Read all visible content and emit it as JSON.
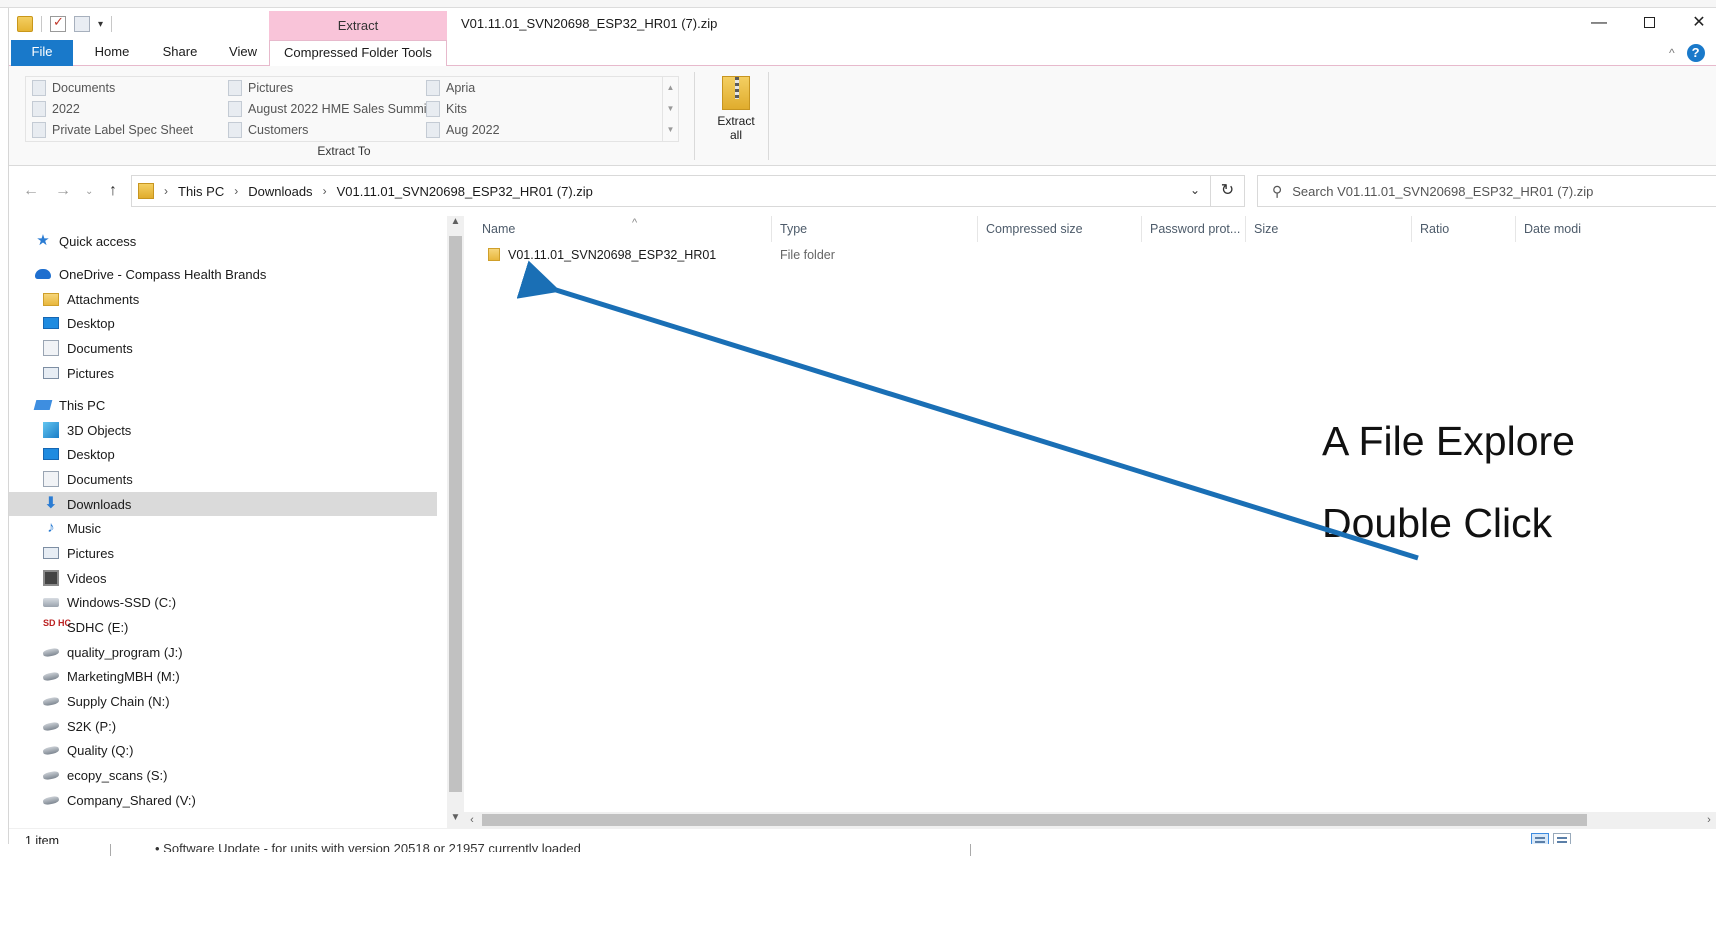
{
  "window": {
    "title": "V01.11.01_SVN20698_ESP32_HR01 (7).zip",
    "context_tab_group": "Extract"
  },
  "ribbon_tabs": [
    "File",
    "Home",
    "Share",
    "View",
    "Compressed Folder Tools"
  ],
  "ribbon": {
    "gallery": [
      [
        "Documents",
        "Pictures",
        "Apria"
      ],
      [
        "2022",
        "August 2022 HME Sales Summit",
        "Kits"
      ],
      [
        "Private Label Spec Sheet",
        "Customers",
        "Aug 2022"
      ]
    ],
    "extract_to_label": "Extract To",
    "extract_all_label_1": "Extract",
    "extract_all_label_2": "all"
  },
  "address": {
    "crumbs": [
      "This PC",
      "Downloads",
      "V01.11.01_SVN20698_ESP32_HR01 (7).zip"
    ],
    "search_placeholder": "Search V01.11.01_SVN20698_ESP32_HR01 (7).zip"
  },
  "navpane": {
    "quick_access": "Quick access",
    "onedrive": "OneDrive - Compass Health Brands",
    "onedrive_items": [
      "Attachments",
      "Desktop",
      "Documents",
      "Pictures"
    ],
    "this_pc": "This PC",
    "pc_items": [
      "3D Objects",
      "Desktop",
      "Documents",
      "Downloads",
      "Music",
      "Pictures",
      "Videos",
      "Windows-SSD (C:)",
      "SDHC (E:)",
      "quality_program (J:)",
      "MarketingMBH (M:)",
      "Supply Chain (N:)",
      "S2K (P:)",
      "Quality (Q:)",
      "ecopy_scans (S:)",
      "Company_Shared (V:)"
    ],
    "selected": "Downloads"
  },
  "columns": [
    "Name",
    "Type",
    "Compressed size",
    "Password prot...",
    "Size",
    "Ratio",
    "Date modi"
  ],
  "rows": [
    {
      "name": "V01.11.01_SVN20698_ESP32_HR01",
      "type": "File folder"
    }
  ],
  "annotation": {
    "line1": "A File Explore",
    "line2": "Double Click",
    "arrow_color": "#1a6fb5"
  },
  "status": {
    "item_count": "1 item"
  },
  "background_doc": {
    "bullet_text": "•  Software Update - for units with version 20518 or 21957 currently loaded"
  },
  "colors": {
    "accent": "#1979ca",
    "context_tab": "#f9c4d9",
    "selection": "#dadada"
  }
}
